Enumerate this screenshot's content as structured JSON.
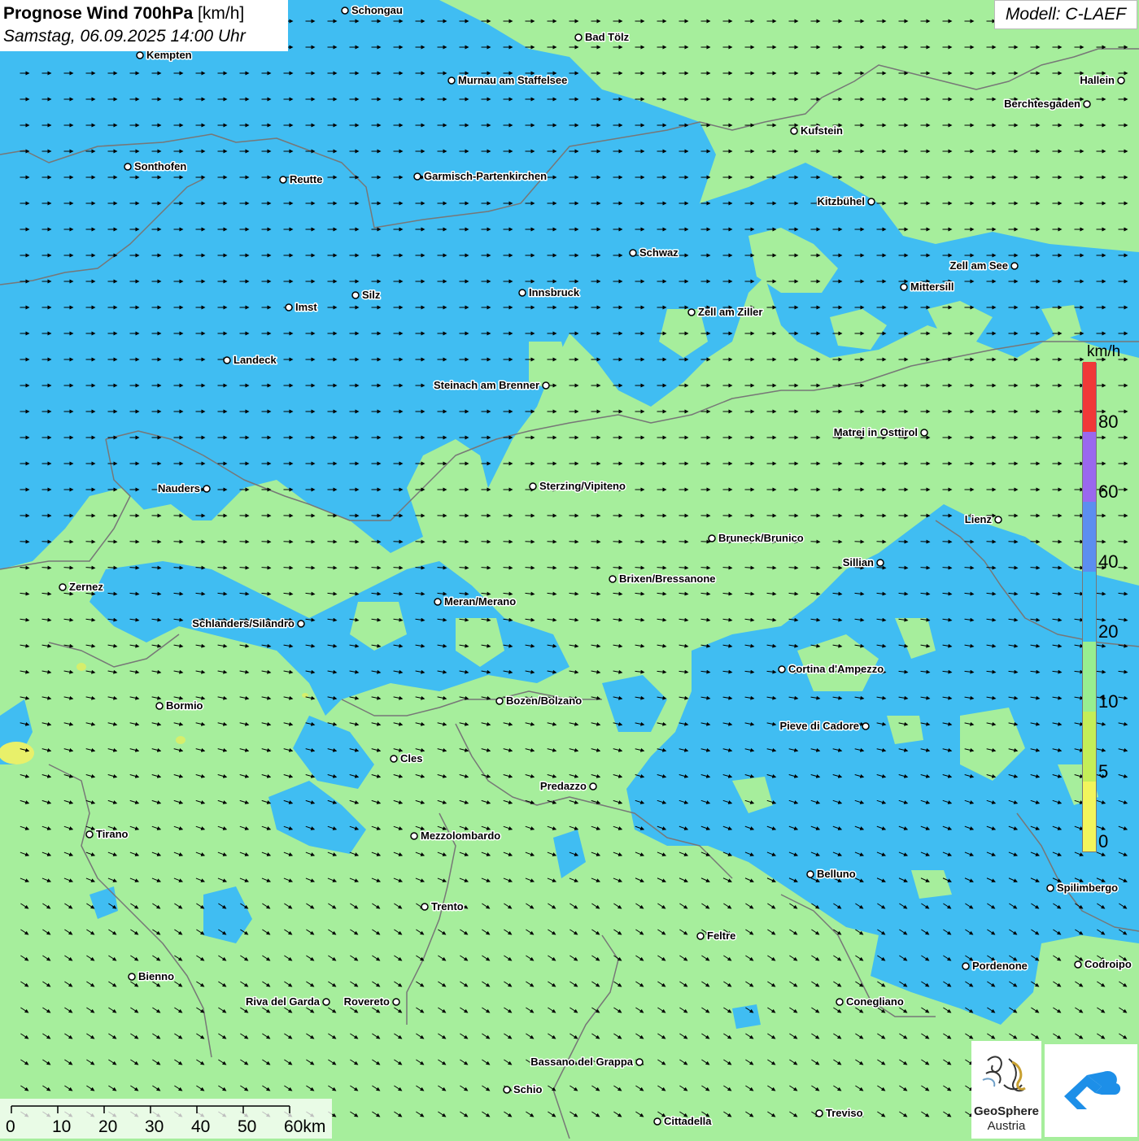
{
  "header": {
    "title_bold": "Prognose Wind 700hPa",
    "title_unit": " [km/h]",
    "datetime": "Samstag, 06.09.2025 14:00 Uhr",
    "model": "Modell: C-LAEF"
  },
  "legend": {
    "unit": "km/h",
    "classes": [
      {
        "label": "0",
        "color": "#f2f55c"
      },
      {
        "label": "5",
        "color": "#c4ee58"
      },
      {
        "label": "10",
        "color": "#98ee90"
      },
      {
        "label": "20",
        "color": "#38bdf2"
      },
      {
        "label": "40",
        "color": "#5c8ef0"
      },
      {
        "label": "60",
        "color": "#9a68ee"
      },
      {
        "label": "80",
        "color": "#f03838"
      }
    ]
  },
  "scale_bar": {
    "labels": [
      "0",
      "10",
      "20",
      "30",
      "40",
      "50",
      "60km"
    ]
  },
  "cities": [
    {
      "name": "Schongau"
    },
    {
      "name": "Bad Tölz"
    },
    {
      "name": "Kempten"
    },
    {
      "name": "Hallein"
    },
    {
      "name": "Murnau am Staffelsee"
    },
    {
      "name": "Berchtesgaden"
    },
    {
      "name": "Kufstein"
    },
    {
      "name": "Sonthofen"
    },
    {
      "name": "Reutte"
    },
    {
      "name": "Garmisch-Partenkirchen"
    },
    {
      "name": "Kitzbühel"
    },
    {
      "name": "Schwaz"
    },
    {
      "name": "Zell am See"
    },
    {
      "name": "Mittersill"
    },
    {
      "name": "Silz"
    },
    {
      "name": "Innsbruck"
    },
    {
      "name": "Imst"
    },
    {
      "name": "Zell am Ziller"
    },
    {
      "name": "Landeck"
    },
    {
      "name": "Steinach am Brenner"
    },
    {
      "name": "Matrei in Osttirol"
    },
    {
      "name": "Nauders"
    },
    {
      "name": "Sterzing/Vipiteno"
    },
    {
      "name": "Lienz"
    },
    {
      "name": "Bruneck/Brunico"
    },
    {
      "name": "Sillian"
    },
    {
      "name": "Brixen/Bressanone"
    },
    {
      "name": "Zernez"
    },
    {
      "name": "Meran/Merano"
    },
    {
      "name": "Schlanders/Silandro"
    },
    {
      "name": "Cortina d'Ampezzo"
    },
    {
      "name": "Bozen/Bolzano"
    },
    {
      "name": "Bormio"
    },
    {
      "name": "Pieve di Cadore"
    },
    {
      "name": "Cles"
    },
    {
      "name": "Predazzo"
    },
    {
      "name": "Tirano"
    },
    {
      "name": "Mezzolombardo"
    },
    {
      "name": "Belluno"
    },
    {
      "name": "Spilimbergo"
    },
    {
      "name": "Trento"
    },
    {
      "name": "Feltre"
    },
    {
      "name": "Pordenone"
    },
    {
      "name": "Codroipo"
    },
    {
      "name": "Bienno"
    },
    {
      "name": "Riva del Garda"
    },
    {
      "name": "Rovereto"
    },
    {
      "name": "Conegliano"
    },
    {
      "name": "Bassano del Grappa"
    },
    {
      "name": "Schio"
    },
    {
      "name": "Treviso"
    },
    {
      "name": "Cittadella"
    }
  ],
  "logos": {
    "geosphere_name": "GeoSphere",
    "geosphere_sub": "Austria"
  }
}
